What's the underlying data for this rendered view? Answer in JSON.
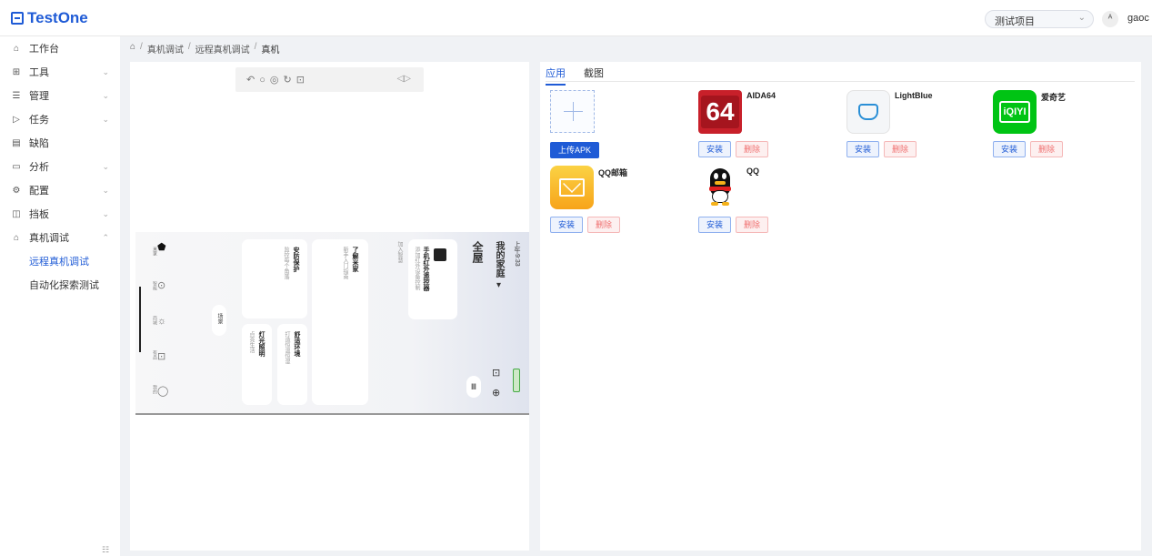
{
  "header": {
    "logo_text": "TestOne",
    "project_select": "测试项目",
    "lang_icon": "translate-icon",
    "username": "gaoc"
  },
  "sidebar": {
    "items": [
      {
        "label": "工作台",
        "icon": "home-icon"
      },
      {
        "label": "工具",
        "icon": "grid-icon"
      },
      {
        "label": "管理",
        "icon": "list-icon"
      },
      {
        "label": "任务",
        "icon": "send-icon"
      },
      {
        "label": "缺陷",
        "icon": "doc-icon"
      },
      {
        "label": "分析",
        "icon": "calendar-icon"
      },
      {
        "label": "配置",
        "icon": "gear-icon"
      },
      {
        "label": "挡板",
        "icon": "panel-icon"
      },
      {
        "label": "真机调试",
        "icon": "device-icon"
      }
    ],
    "sub_items": [
      {
        "label": "远程真机调试",
        "active": true
      },
      {
        "label": "自动化探索测试",
        "active": false
      }
    ]
  },
  "breadcrumb": [
    "真机调试",
    "远程真机调试",
    "真机"
  ],
  "device": {
    "controls": [
      "↶",
      "○",
      "◎",
      "↻",
      "🔒"
    ],
    "volume_icon": "volume-icon",
    "screen": {
      "status_time": "上午9:33",
      "home_title": "我的家庭 ▾",
      "section_all": "全屋",
      "card1_title": "手机红外遥控器",
      "card1_sub": "添加红外设备控制",
      "card_hint": "加入智慧",
      "card2_title": "了解米家",
      "card2_sub": "新手入门指南",
      "card3_title": "安防保护",
      "card3_sub": "监控每个角落",
      "card4_title": "舒适环境",
      "card4_sub": "打造恒温恒湿",
      "card5_title": "灯光照明",
      "card5_sub": "点亮生活",
      "badge": "场景",
      "nav": [
        "米家",
        "智能",
        "商城",
        "有品",
        "我的"
      ]
    }
  },
  "tabs": [
    "应用",
    "截图"
  ],
  "apps_panel": {
    "upload_label": "上传APK",
    "install_label": "安装",
    "delete_label": "删除",
    "apps": [
      {
        "name": "AIDA64",
        "icon": "aida64-icon",
        "icon_text": "64"
      },
      {
        "name": "LightBlue",
        "icon": "lightblue-icon"
      },
      {
        "name": "爱奇艺",
        "icon": "iqiyi-icon",
        "icon_text": "iQIYI"
      },
      {
        "name": "QQ邮箱",
        "icon": "qqmail-icon"
      },
      {
        "name": "QQ",
        "icon": "qq-icon"
      }
    ]
  },
  "colors": {
    "primary": "#1f5bd6",
    "delete": "#f07070",
    "aida_red": "#c8202a",
    "iqiyi_green": "#00c414",
    "qqmail_yellow": "#f9b81d"
  }
}
